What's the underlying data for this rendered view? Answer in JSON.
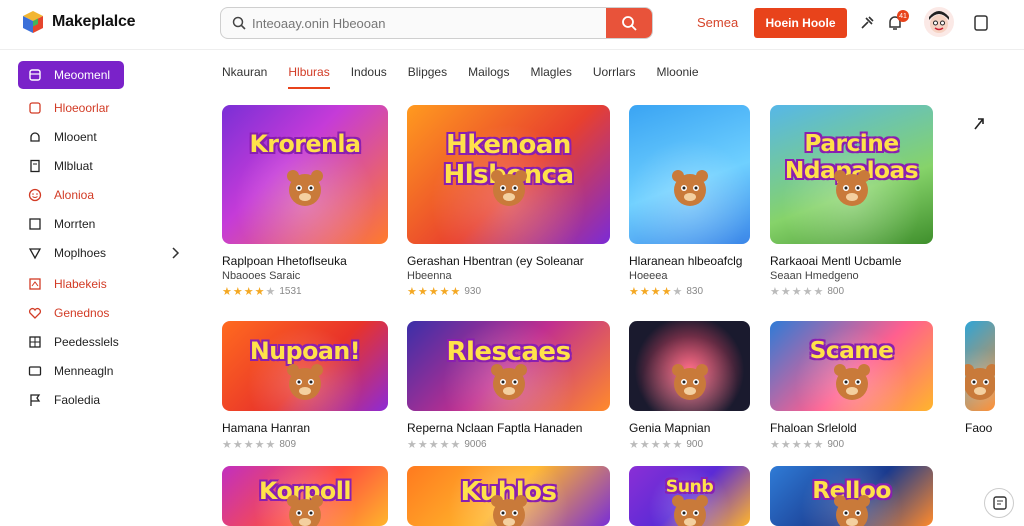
{
  "app": {
    "name": "Makeplalce"
  },
  "search": {
    "placeholder": "Inteoaay.onin Hbeooan"
  },
  "header": {
    "link": "Semea",
    "cta": "Hoein Hoole",
    "badge_count": "41"
  },
  "sidebar": {
    "items": [
      {
        "label": "Meoomenl",
        "icon": "box-icon",
        "active": true
      },
      {
        "label": "Hloeoorlar",
        "icon": "square-outline-icon",
        "red": true
      },
      {
        "label": "Mlooent",
        "icon": "bell-icon"
      },
      {
        "label": "Mlbluat",
        "icon": "document-icon"
      },
      {
        "label": "Alonioa",
        "icon": "smiley-icon",
        "red": true
      },
      {
        "label": "Morrten",
        "icon": "square-icon"
      },
      {
        "label": "Moplhoes",
        "icon": "triangle-icon",
        "chevron": true
      },
      {
        "label": "Hlabekeis",
        "icon": "cube-icon",
        "red": true
      },
      {
        "label": "Genednos",
        "icon": "heart-icon",
        "red": true
      },
      {
        "label": "Peedesslels",
        "icon": "grid-icon"
      },
      {
        "label": "Menneagln",
        "icon": "card-icon"
      },
      {
        "label": "Faoledia",
        "icon": "flag-icon"
      }
    ]
  },
  "tabs": [
    {
      "label": "Nkauran"
    },
    {
      "label": "Hlburas",
      "active": true
    },
    {
      "label": "Indous"
    },
    {
      "label": "Blipges"
    },
    {
      "label": "Mailogs"
    },
    {
      "label": "Mlagles"
    },
    {
      "label": "Uorrlars"
    },
    {
      "label": "Mloonie"
    }
  ],
  "cards": [
    {
      "title": "Raplpoan Hhetoflseuka",
      "sub": "Nbaooes Saraic",
      "rating": 4,
      "count": "1531",
      "art": "Krorenla"
    },
    {
      "title": "Gerashan Hbentran (ey Soleanar",
      "sub": "Hbeenna",
      "rating": 5,
      "count": "930",
      "art": "Hkenoan Hlsbonca"
    },
    {
      "title": "Hlaranean hlbeoafclg",
      "sub": "Hoeeea",
      "rating": 4,
      "count": "830",
      "art": ""
    },
    {
      "title": "Rarkaoai Mentl Ucbamle",
      "sub": "Seaan Hmedgeno",
      "rating": 0,
      "count": "800",
      "art": "Parcine Ndapaloas"
    },
    {
      "title": "Hamana Hanran",
      "sub": "",
      "rating": 0,
      "count": "809",
      "art": "Nupoan!"
    },
    {
      "title": "Reperna Nclaan Faptla Hanaden",
      "sub": "",
      "rating": 0,
      "count": "9006",
      "art": "Rlescaes"
    },
    {
      "title": "Genia Mapnian",
      "sub": "",
      "rating": 0,
      "count": "900",
      "art": ""
    },
    {
      "title": "Fhaloan Srlelold",
      "sub": "",
      "rating": 0,
      "count": "900",
      "art": "Scame"
    },
    {
      "title": "Faoo",
      "sub": "",
      "rating": 0,
      "count": "",
      "art": ""
    },
    {
      "title": "",
      "sub": "",
      "rating": 0,
      "count": "",
      "art": "Korpoll"
    },
    {
      "title": "",
      "sub": "",
      "rating": 0,
      "count": "",
      "art": "Kuhlos"
    },
    {
      "title": "",
      "sub": "",
      "rating": 0,
      "count": "",
      "art": "Sunb"
    },
    {
      "title": "",
      "sub": "",
      "rating": 0,
      "count": "",
      "art": "Relloo"
    }
  ],
  "colors": {
    "accent": "#e8431b",
    "purple": "#7a22c9",
    "red_text": "#d23b25"
  }
}
